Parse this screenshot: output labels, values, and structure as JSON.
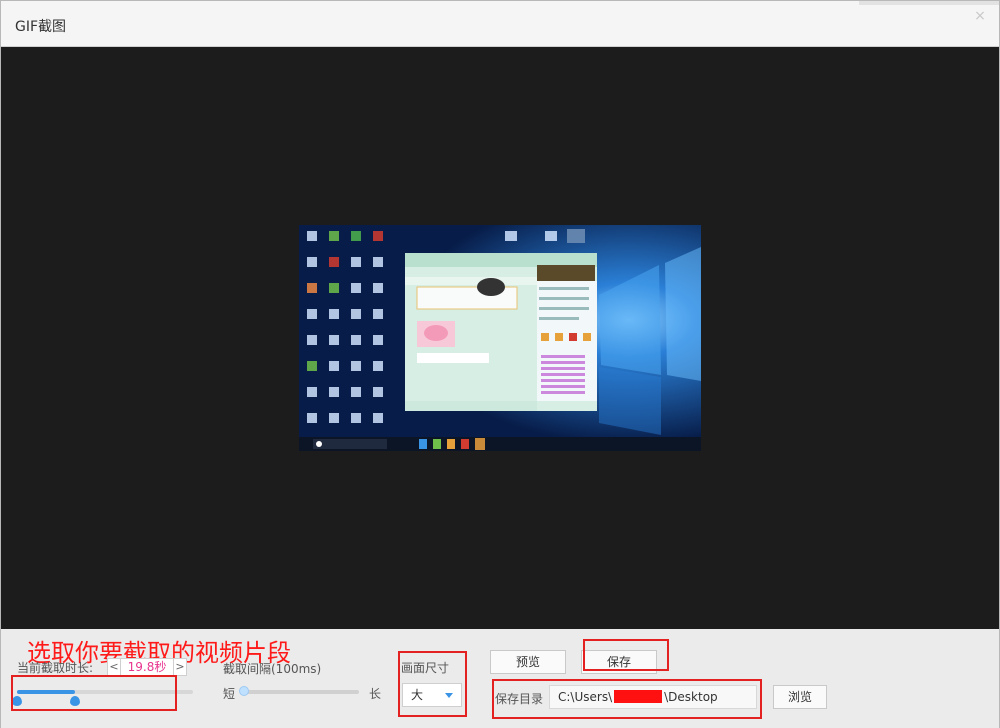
{
  "window": {
    "title": "GIF截图",
    "close_label": "×"
  },
  "annotation": {
    "text": "选取你要截取的视频片段"
  },
  "duration": {
    "label": "当前截取时长:",
    "prev": "<",
    "value": "19.8秒",
    "next": ">"
  },
  "interval": {
    "label": "截取间隔(100ms)",
    "short_label": "短",
    "long_label": "长"
  },
  "size": {
    "label": "画面尺寸",
    "selected": "大"
  },
  "actions": {
    "preview_label": "预览",
    "save_label": "保存",
    "browse_label": "浏览"
  },
  "save_dir": {
    "label": "保存目录",
    "path_prefix": "C:\\Users\\",
    "path_suffix": "\\Desktop"
  },
  "colors": {
    "annotation_red": "#ff1a1a",
    "accent_blue": "#3a94e6",
    "duration_pink": "#e8358f",
    "preview_bg": "#1c1c1c"
  }
}
